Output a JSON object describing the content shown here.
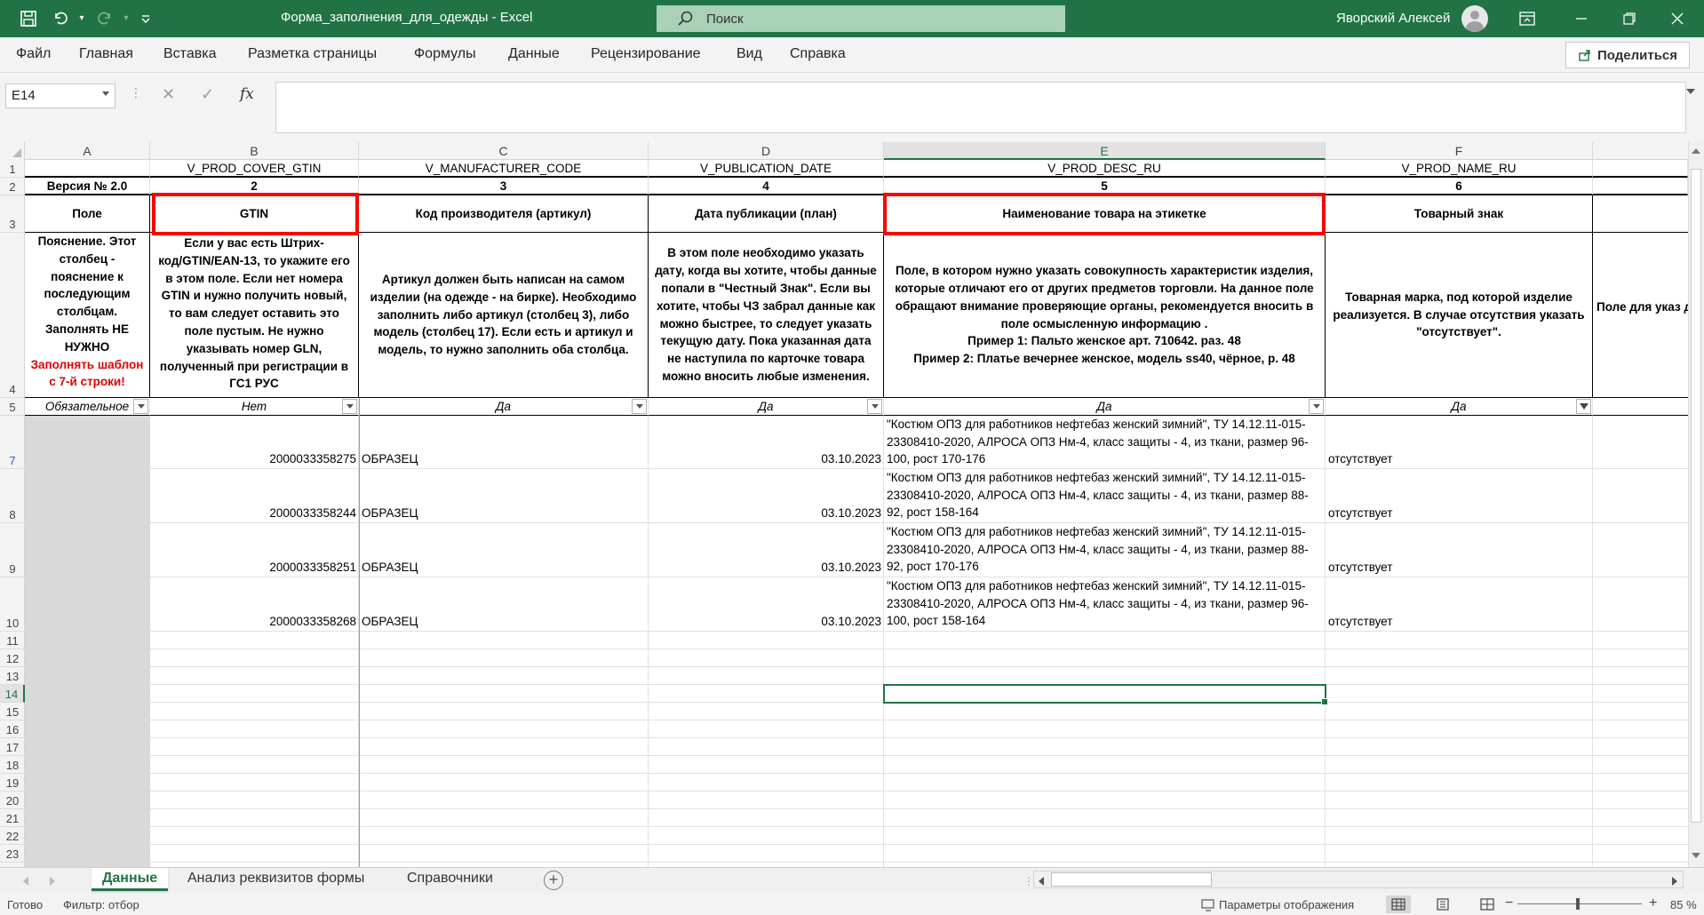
{
  "titlebar": {
    "doc_title": "Форма_заполнения_для_одежды  -  Excel",
    "search_placeholder": "Поиск",
    "user_name": "Яворский Алексей"
  },
  "ribbon": {
    "tabs": [
      "Файл",
      "Главная",
      "Вставка",
      "Разметка страницы",
      "Формулы",
      "Данные",
      "Рецензирование",
      "Вид",
      "Справка"
    ],
    "share_label": "Поделиться"
  },
  "formula_bar": {
    "name_box": "E14",
    "fx": "fx",
    "formula": ""
  },
  "columns": [
    "A",
    "B",
    "C",
    "D",
    "E",
    "F"
  ],
  "rows": {
    "r1": {
      "B": "V_PROD_COVER_GTIN",
      "C": "V_MANUFACTURER_CODE",
      "D": "V_PUBLICATION_DATE",
      "E": "V_PROD_DESC_RU",
      "F": "V_PROD_NAME_RU"
    },
    "r2": {
      "A": "Версия № 2.0",
      "B": "2",
      "C": "3",
      "D": "4",
      "E": "5",
      "F": "6"
    },
    "r3": {
      "A": "Поле",
      "B": "GTIN",
      "C": "Код производителя (артикул)",
      "D": "Дата публикации (план)",
      "E": "Наименование товара на этикетке",
      "F": "Товарный знак"
    },
    "r4": {
      "A": "Пояснение. Этот столбец - пояснение к последующим столбцам. Заполнять НЕ НУЖНО",
      "A_red": "Заполнять шаблон с 7-й строки!",
      "B": "Если у вас есть Штрих-код/GTIN/EAN-13, то укажите его в этом поле. Если нет номера GTIN и нужно получить новый, то вам следует оставить это поле пустым. Не нужно указывать номер GLN, полученный при регистрации в ГС1 РУС",
      "C": "Артикул должен быть написан на самом изделии (на одежде - на бирке). Необходимо заполнить либо артикул (столбец 3), либо модель (столбец 17). Если есть и артикул и модель, то нужно заполнить оба столбца.",
      "D": "В этом поле необходимо указать дату, когда вы хотите, чтобы данные попали в \"Честный Знак\". Если вы хотите, чтобы ЧЗ забрал данные как можно быстрее, то следует указать текущую дату. Пока указанная дата не наступила по карточке товара можно вносить любые изменения.",
      "E": "Поле, в котором нужно указать совокупность характеристик изделия, которые отличают его от других предметов торговли. На данное поле обращают внимание проверяющие органы, рекомендуется вносить в поле осмысленную информацию .\nПример 1: Пальто женское арт. 710642. раз. 48\nПример 2:  Платье вечернее женское, модель ss40, чёрное, р. 48",
      "F": "Товарная марка, под которой изделие реализуется. В случае отсутствия указать \"отсутствует\".",
      "G": "Поле для указ данный про"
    },
    "r5": {
      "A": "Обязательное",
      "B": "Нет",
      "C": "Да",
      "D": "Да",
      "E": "Да",
      "F": "Да"
    },
    "data": [
      {
        "row": "7",
        "B": "2000033358275",
        "C": "ОБРАЗЕЦ",
        "D": "03.10.2023",
        "E": "\"Костюм ОПЗ для работников нефтебаз женский зимний\", ТУ 14.12.11-015-23308410-2020, АЛРОСА ОПЗ Нм-4, класс защиты - 4, из ткани, размер 96-100, рост 170-176",
        "F": "отсутствует"
      },
      {
        "row": "8",
        "B": "2000033358244",
        "C": "ОБРАЗЕЦ",
        "D": "03.10.2023",
        "E": "\"Костюм ОПЗ для работников нефтебаз женский зимний\", ТУ 14.12.11-015-23308410-2020, АЛРОСА ОПЗ Нм-4, класс защиты - 4, из ткани, размер 88-92, рост 158-164",
        "F": "отсутствует"
      },
      {
        "row": "9",
        "B": "2000033358251",
        "C": "ОБРАЗЕЦ",
        "D": "03.10.2023",
        "E": "\"Костюм ОПЗ для работников нефтебаз женский зимний\", ТУ 14.12.11-015-23308410-2020, АЛРОСА ОПЗ Нм-4, класс защиты - 4, из ткани, размер 88-92, рост 170-176",
        "F": "отсутствует"
      },
      {
        "row": "10",
        "B": "2000033358268",
        "C": "ОБРАЗЕЦ",
        "D": "03.10.2023",
        "E": "\"Костюм ОПЗ для работников нефтебаз женский зимний\", ТУ 14.12.11-015-23308410-2020, АЛРОСА ОПЗ Нм-4, класс защиты - 4, из ткани, размер 96-100, рост 158-164",
        "F": "отсутствует"
      }
    ]
  },
  "row_numbers": [
    "1",
    "2",
    "3",
    "4",
    "5",
    "7",
    "8",
    "9",
    "10",
    "11",
    "12",
    "13",
    "14",
    "15",
    "16",
    "17",
    "18",
    "19",
    "20",
    "21",
    "22",
    "23"
  ],
  "sheet_tabs": [
    "Данные",
    "Анализ реквизитов формы",
    "Справочники"
  ],
  "status": {
    "ready": "Готово",
    "filter": "Фильтр: отбор",
    "display_settings": "Параметры отображения",
    "zoom": "85 %"
  },
  "colors": {
    "accent": "#217346",
    "highlight": "#ff0000",
    "red_text": "#e00000"
  }
}
